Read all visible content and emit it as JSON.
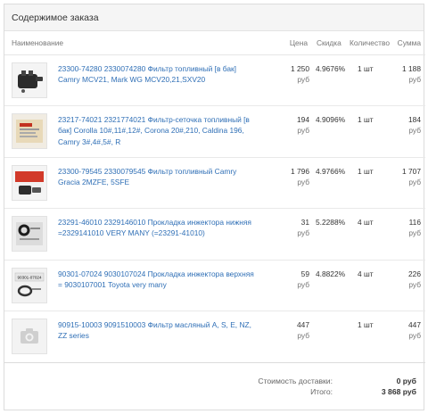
{
  "panel": {
    "title": "Содержимое заказа"
  },
  "columns": {
    "name": "Наименование",
    "price": "Цена",
    "discount": "Скидка",
    "qty": "Количество",
    "sum": "Сумма"
  },
  "items": [
    {
      "name": "23300-74280 2330074280 Фильтр топливный [в бак] Camry MCV21, Mark WG MCV20,21,SXV20",
      "price": "1 250",
      "price_cur": "руб",
      "discount": "4.9676%",
      "qty": "1 шт",
      "sum": "1 188",
      "sum_cur": "руб",
      "thumb_icon": "fuel-filter-photo"
    },
    {
      "name": "23217-74021 2321774021 Фильтр-сеточка топливный [в бак] Corolla 10#,11#,12#, Corona 20#,210, Caldina 196, Camry 3#,4#,5#, R",
      "price": "194",
      "price_cur": "руб",
      "discount": "4.9096%",
      "qty": "1 шт",
      "sum": "184",
      "sum_cur": "руб",
      "thumb_icon": "filter-screen-photo"
    },
    {
      "name": "23300-79545 2330079545 Фильтр топливный Camry Gracia 2MZFE, 5SFE",
      "price": "1 796",
      "price_cur": "руб",
      "discount": "4.9766%",
      "qty": "1 шт",
      "sum": "1 707",
      "sum_cur": "руб",
      "thumb_icon": "fuel-filter-box-photo"
    },
    {
      "name": "23291-46010 2329146010 Прокладка инжектора нижняя =2329141010 VERY MANY (=23291-41010)",
      "price": "31",
      "price_cur": "руб",
      "discount": "5.2288%",
      "qty": "4 шт",
      "sum": "116",
      "sum_cur": "руб",
      "thumb_icon": "gasket-lower-photo"
    },
    {
      "name": "90301-07024 9030107024 Прокладка инжектора верхняя = 9030107001 Toyota very many",
      "price": "59",
      "price_cur": "руб",
      "discount": "4.8822%",
      "qty": "4 шт",
      "sum": "226",
      "sum_cur": "руб",
      "thumb_icon": "gasket-upper-photo",
      "thumb_text": "90301-07024"
    },
    {
      "name": "90915-10003 9091510003 Фильтр масляный A, S, E, NZ, ZZ series",
      "price": "447",
      "price_cur": "руб",
      "discount": "",
      "qty": "1 шт",
      "sum": "447",
      "sum_cur": "руб",
      "thumb_icon": "camera-placeholder-icon"
    }
  ],
  "totals": {
    "delivery_label": "Стоимость доставки:",
    "delivery_value": "0 руб",
    "total_label": "Итого:",
    "total_value": "3 868 руб"
  },
  "colors": {
    "link": "#2f6fb6",
    "header_bg": "#f5f5f5",
    "border": "#dcdcdc"
  }
}
